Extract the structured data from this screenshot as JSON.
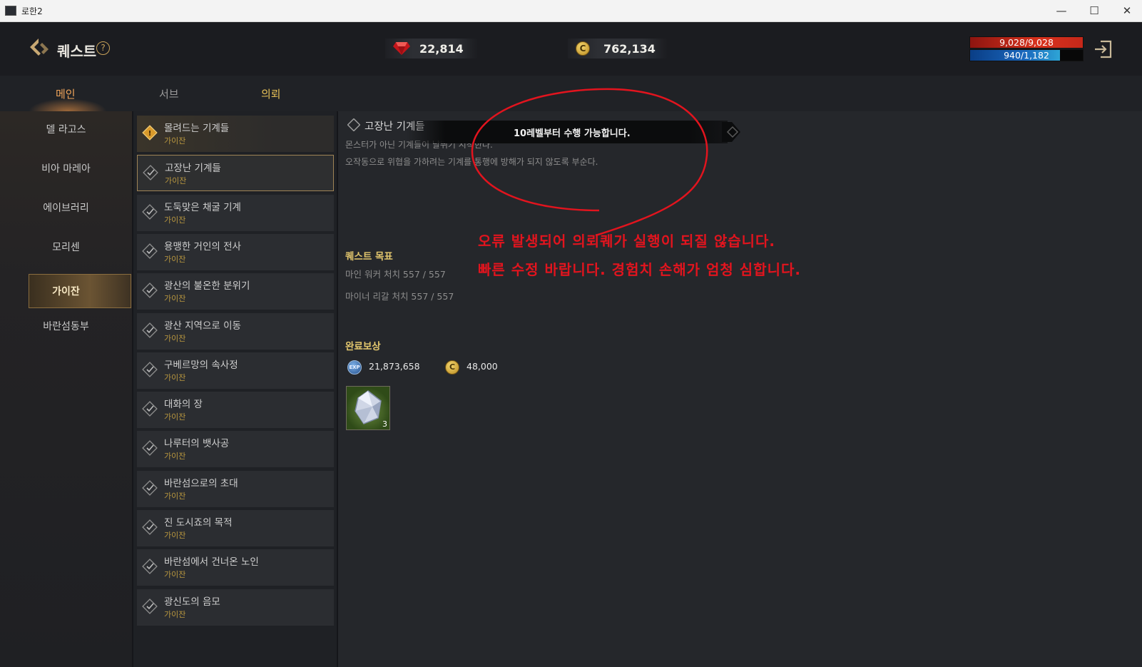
{
  "window": {
    "title": "로한2",
    "minimize_glyph": "—",
    "maximize_glyph": "☐",
    "close_glyph": "✕"
  },
  "header": {
    "title": "퀘스트",
    "help_glyph": "?",
    "gems": "22,814",
    "gold": "762,134",
    "gold_glyph": "C",
    "hp": "9,028/9,028",
    "mp": "940/1,182",
    "hp_fraction": 1.0,
    "mp_fraction": 0.795
  },
  "tabs": [
    {
      "label": "메인",
      "state": "active"
    },
    {
      "label": "서브",
      "state": "inactive"
    },
    {
      "label": "의뢰",
      "state": "highlighted"
    }
  ],
  "regions": [
    {
      "label": "델 라고스"
    },
    {
      "label": "비아 마레아"
    },
    {
      "label": "에이브러리"
    },
    {
      "label": "모리센"
    },
    {
      "label": "가이잔",
      "selected": true
    },
    {
      "label": "바란섬동부"
    }
  ],
  "quests": [
    {
      "name": "몰려드는 기계들",
      "region": "가이잔",
      "status": "active"
    },
    {
      "name": "고장난 기계들",
      "region": "가이잔",
      "status": "selected"
    },
    {
      "name": "도둑맞은 채굴 기계",
      "region": "가이잔",
      "status": "done"
    },
    {
      "name": "용맹한 거인의 전사",
      "region": "가이잔",
      "status": "done"
    },
    {
      "name": "광산의 불온한 분위기",
      "region": "가이잔",
      "status": "done"
    },
    {
      "name": "광산 지역으로 이동",
      "region": "가이잔",
      "status": "done"
    },
    {
      "name": "구베르망의 속사정",
      "region": "가이잔",
      "status": "done"
    },
    {
      "name": "대화의 장",
      "region": "가이잔",
      "status": "done"
    },
    {
      "name": "나루터의 뱃사공",
      "region": "가이잔",
      "status": "done"
    },
    {
      "name": "바란섬으로의 초대",
      "region": "가이잔",
      "status": "done"
    },
    {
      "name": "진 도시죠의 목적",
      "region": "가이잔",
      "status": "done"
    },
    {
      "name": "바란섬에서 건너온 노인",
      "region": "가이잔",
      "status": "done"
    },
    {
      "name": "광신도의 음모",
      "region": "가이잔",
      "status": "done"
    }
  ],
  "detail": {
    "title": "고장난 기계들",
    "desc_line1": "몬스터가 아닌 기계들이 날뛰기 시작한다.",
    "desc_line2": "오작동으로 위협을 가하려는 기계를 통행에 방해가 되지 않도록 부순다.",
    "toast": "10레벨부터 수행 가능합니다.",
    "objective_header": "퀘스트 목표",
    "objectives": [
      "마인 워커 처치 557 / 557",
      "마이너 리갈 처치 557 / 557"
    ],
    "reward_header": "완료보상",
    "reward_exp": "21,873,658",
    "reward_exp_glyph": "EXP",
    "reward_gold": "48,000",
    "reward_gold_glyph": "C",
    "reward_item_count": "3"
  },
  "annotation": {
    "line1": "오류 발생되어 의뢰퀘가 실행이 되질 않습니다.",
    "line2": "빠른 수정 바랍니다. 경험치 손해가 엄청 심합니다.",
    "color": "#e2141e"
  },
  "colors": {
    "accent_gold": "#e3c76e",
    "tab_active": "#f0a45a",
    "hp": "#d8321d",
    "mp": "#1a67bd"
  }
}
